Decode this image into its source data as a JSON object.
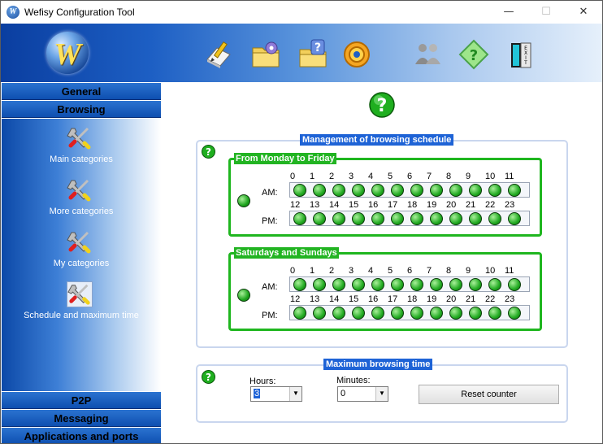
{
  "window": {
    "title": "Wefisy Configuration Tool",
    "app_icon_letter": "W",
    "min_glyph": "—",
    "max_glyph": "☐",
    "close_glyph": "✕"
  },
  "header": {
    "logo_letter": "W",
    "toolbar": [
      "edit-icon",
      "folder-settings-icon",
      "folder-help-icon",
      "settings-icon",
      "users-icon",
      "help-icon",
      "exit-icon"
    ]
  },
  "sidebar": {
    "general": "General",
    "browsing": "Browsing",
    "categories": [
      {
        "label": "Main categories"
      },
      {
        "label": "More categories"
      },
      {
        "label": "My categories"
      },
      {
        "label": "Schedule and maximum time"
      }
    ],
    "p2p": "P2P",
    "messaging": "Messaging",
    "apps": "Applications and ports"
  },
  "schedule": {
    "title": "Management of browsing schedule",
    "weekday": {
      "title": "From Monday to Friday",
      "am_label": "AM:",
      "pm_label": "PM:",
      "am_hours": [
        "0",
        "1",
        "2",
        "3",
        "4",
        "5",
        "6",
        "7",
        "8",
        "9",
        "10",
        "11"
      ],
      "pm_hours": [
        "12",
        "13",
        "14",
        "15",
        "16",
        "17",
        "18",
        "19",
        "20",
        "21",
        "22",
        "23"
      ]
    },
    "weekend": {
      "title": "Saturdays and Sundays",
      "am_label": "AM:",
      "pm_label": "PM:",
      "am_hours": [
        "0",
        "1",
        "2",
        "3",
        "4",
        "5",
        "6",
        "7",
        "8",
        "9",
        "10",
        "11"
      ],
      "pm_hours": [
        "12",
        "13",
        "14",
        "15",
        "16",
        "17",
        "18",
        "19",
        "20",
        "21",
        "22",
        "23"
      ]
    },
    "led_color": "#22aa22"
  },
  "max_time": {
    "title": "Maximum browsing time",
    "hours_label": "Hours:",
    "hours_value": "3",
    "minutes_label": "Minutes:",
    "minutes_value": "0",
    "reset_label": "Reset counter"
  },
  "colors": {
    "accent_blue": "#1e63d6",
    "group_green": "#22b422",
    "nav_blue": "#0e4fb0"
  }
}
